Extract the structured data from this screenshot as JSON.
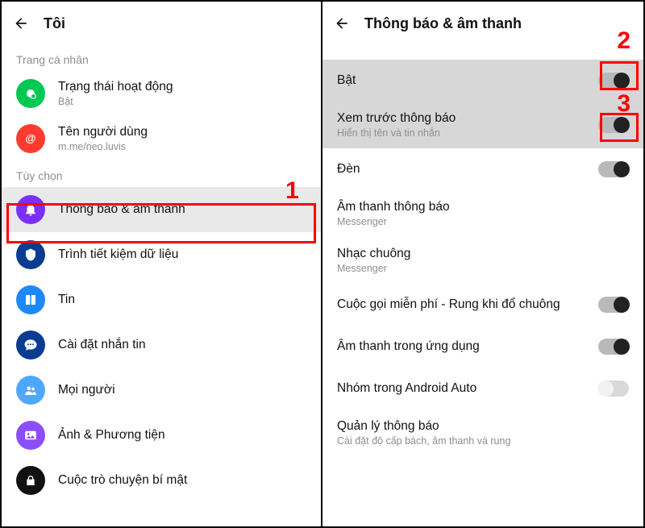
{
  "left": {
    "title": "Tôi",
    "section_personal_label": "Trang cá nhân",
    "rows_personal": [
      {
        "icon": "status-icon",
        "color": "#00c853",
        "label": "Trạng thái hoạt động",
        "sub": "Bật"
      },
      {
        "icon": "at-icon",
        "color": "#ff3b30",
        "label": "Tên người dùng",
        "sub": "m.me/neo.luvis"
      }
    ],
    "section_options_label": "Tùy chọn",
    "rows_options": [
      {
        "icon": "bell-icon",
        "color": "#7b2ff7",
        "label": "Thông báo & âm thanh",
        "selected": true
      },
      {
        "icon": "shield-icon",
        "color": "#0a3d91",
        "label": "Trình tiết kiệm dữ liệu"
      },
      {
        "icon": "story-icon",
        "color": "#1e88ff",
        "label": "Tin"
      },
      {
        "icon": "chat-icon",
        "color": "#0a3d91",
        "label": "Cài đặt nhắn tin"
      },
      {
        "icon": "people-icon",
        "color": "#4fa8ff",
        "label": "Mọi người"
      },
      {
        "icon": "photo-icon",
        "color": "#8a4dff",
        "label": "Ảnh & Phương tiện"
      },
      {
        "icon": "lock-icon",
        "color": "#111111",
        "label": "Cuộc trò chuyện bí mật"
      }
    ]
  },
  "right": {
    "title": "Thông báo & âm thanh",
    "rows": [
      {
        "label": "Bật",
        "toggle": "on",
        "shaded": true
      },
      {
        "label": "Xem trước thông báo",
        "sub": "Hiển thị tên và tin nhắn",
        "toggle": "on",
        "shaded": true
      },
      {
        "label": "Đèn",
        "toggle": "on"
      },
      {
        "label": "Âm thanh thông báo",
        "sub": "Messenger"
      },
      {
        "label": "Nhạc chuông",
        "sub": "Messenger"
      },
      {
        "label": "Cuộc gọi miễn phí - Rung khi đổ chuông",
        "toggle": "on"
      },
      {
        "label": "Âm thanh trong ứng dụng",
        "toggle": "on"
      },
      {
        "label": "Nhóm trong Android Auto",
        "toggle": "off"
      },
      {
        "label": "Quản lý thông báo",
        "sub": "Cài đặt độ cấp bách, âm thanh và rung"
      }
    ]
  },
  "callouts": {
    "one": "1",
    "two": "2",
    "three": "3"
  },
  "colors": {
    "red": "#ff0000"
  }
}
